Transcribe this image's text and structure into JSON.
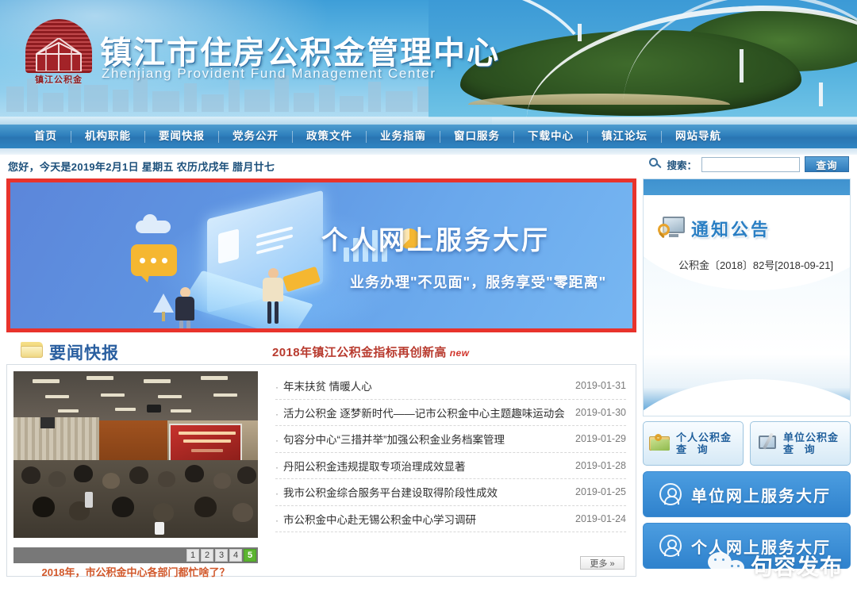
{
  "header": {
    "logo_text": "镇江公积金",
    "title": "镇江市住房公积金管理中心",
    "subtitle": "Zhenjiang Provident Fund Management Center"
  },
  "nav": {
    "items": [
      {
        "label": "首页"
      },
      {
        "label": "机构职能"
      },
      {
        "label": "要闻快报"
      },
      {
        "label": "党务公开"
      },
      {
        "label": "政策文件"
      },
      {
        "label": "业务指南"
      },
      {
        "label": "窗口服务"
      },
      {
        "label": "下载中心"
      },
      {
        "label": "镇江论坛"
      },
      {
        "label": "网站导航"
      }
    ]
  },
  "toprow": {
    "date_text": "您好，今天是2019年2月1日 星期五 农历戊戌年 腊月廿七",
    "search_label": "搜索：",
    "search_value": "",
    "search_placeholder": "",
    "search_button": "查询"
  },
  "banner": {
    "title": "个人网上服务大厅",
    "subtitle": "业务办理\"不见面\"，服务享受\"零距离\"",
    "border_color": "#e8332c"
  },
  "news": {
    "section_title": "要闻快报",
    "headline": "2018年镇江公积金指标再创新高",
    "new_badge": "new",
    "photo_caption": "2018年，市公积金中心各部门都忙啥了？",
    "pager": [
      "1",
      "2",
      "3",
      "4",
      "5"
    ],
    "pager_active": "5",
    "more_label": "更多 »",
    "items": [
      {
        "title": "年末扶贫 情暖人心",
        "date": "2019-01-31"
      },
      {
        "title": "活力公积金 逐梦新时代——记市公积金中心主题趣味运动会",
        "date": "2019-01-30"
      },
      {
        "title": "句容分中心“三措并举”加强公积金业务档案管理",
        "date": "2019-01-29"
      },
      {
        "title": "丹阳公积金违规提取专项治理成效显著",
        "date": "2019-01-28"
      },
      {
        "title": "我市公积金综合服务平台建设取得阶段性成效",
        "date": "2019-01-25"
      },
      {
        "title": "市公积金中心赴无锡公积金中心学习调研",
        "date": "2019-01-24"
      }
    ]
  },
  "sidebar": {
    "notice_title": "通知公告",
    "notices": [
      {
        "text": "公积金〔2018〕82号[2018-09-21]"
      }
    ],
    "query_buttons": [
      {
        "line1": "个人公积金",
        "line2": "查 询"
      },
      {
        "line1": "单位公积金",
        "line2": "查 询"
      }
    ],
    "big_buttons": [
      {
        "label": "单位网上服务大厅"
      },
      {
        "label": "个人网上服务大厅"
      }
    ]
  },
  "watermark": {
    "text": "句容发布"
  },
  "colors": {
    "accent_blue": "#2a7fc4",
    "nav_blue": "#2f80bd",
    "red_border": "#e8332c",
    "news_red": "#b83a2e",
    "caption_orange": "#d1582b",
    "pager_green": "#5cb531"
  }
}
